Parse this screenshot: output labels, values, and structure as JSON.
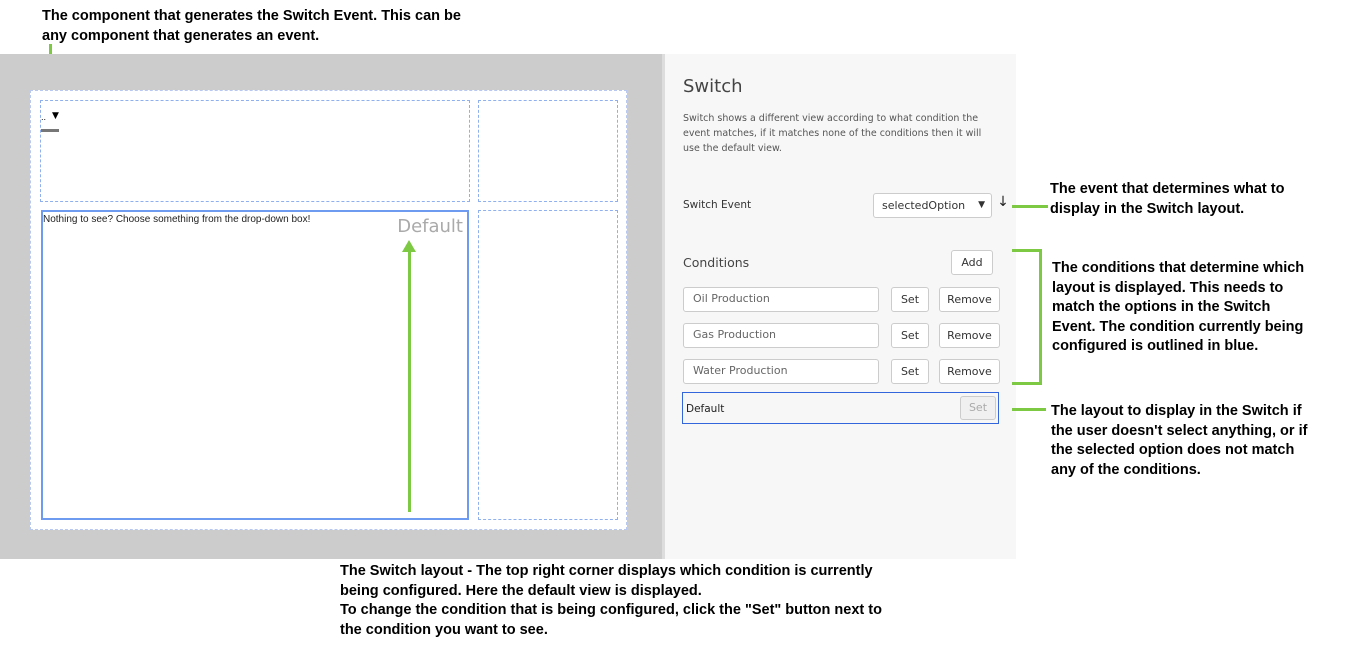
{
  "annotations": {
    "component": "The component that generates the Switch Event. This can be any component that generates an event.",
    "event": "The event that determines what to display in the Switch layout.",
    "conditions": "The conditions that determine which layout is displayed. This needs to match the options in the Switch Event. The condition currently being configured is outlined in blue.",
    "default": "The layout to display in the Switch if the user doesn't select anything, or if the selected option does not match any of the conditions.",
    "layout_line1": "The Switch layout - The top right corner displays which condition is currently being configured. Here the default view is displayed.",
    "layout_line2": "To change the condition that is being configured, click the \"Set\" button next to the condition you want to see."
  },
  "canvas": {
    "dropdown_value": "..",
    "message": "Nothing to see? Choose something from the drop-down box!",
    "current_condition": "Default"
  },
  "panel": {
    "title": "Switch",
    "description": "Switch shows a different view according to what condition the event matches, if it matches none of the conditions then it will use the default view.",
    "switch_event_label": "Switch Event",
    "switch_event_value": "selectedOption",
    "conditions_label": "Conditions",
    "add_label": "Add",
    "set_label": "Set",
    "remove_label": "Remove",
    "conditions": [
      "Oil Production",
      "Gas Production",
      "Water Production"
    ],
    "default_label": "Default"
  },
  "colors": {
    "accent": "#3366dd",
    "arrow": "#7dc943"
  }
}
